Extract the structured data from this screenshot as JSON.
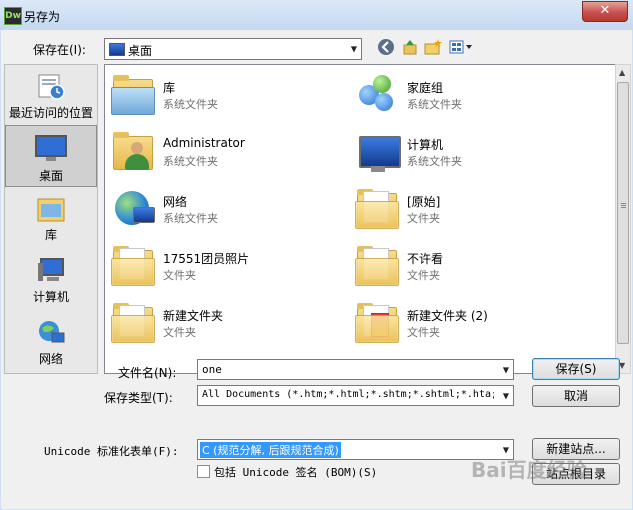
{
  "window": {
    "title": "另存为",
    "app_icon_text": "Dw",
    "close_symbol": "✕"
  },
  "toolbar": {
    "save_in_label": "保存在(I):",
    "location": "桌面",
    "back_icon": "back-arrow-icon",
    "up_icon": "up-folder-icon",
    "new_folder_icon": "new-folder-icon",
    "view_icon": "view-menu-icon"
  },
  "places": [
    {
      "label": "最近访问的位置",
      "icon": "recent-places-icon"
    },
    {
      "label": "桌面",
      "icon": "desktop-icon",
      "selected": true
    },
    {
      "label": "库",
      "icon": "libraries-icon"
    },
    {
      "label": "计算机",
      "icon": "computer-icon"
    },
    {
      "label": "网络",
      "icon": "network-icon"
    }
  ],
  "files": [
    {
      "name": "库",
      "type": "系统文件夹",
      "icon": "libraries-icon"
    },
    {
      "name": "家庭组",
      "type": "系统文件夹",
      "icon": "homegroup-icon"
    },
    {
      "name": "Administrator",
      "type": "系统文件夹",
      "icon": "user-folder-icon"
    },
    {
      "name": "计算机",
      "type": "系统文件夹",
      "icon": "computer-icon"
    },
    {
      "name": "网络",
      "type": "系统文件夹",
      "icon": "network-icon"
    },
    {
      "name": "[原始]",
      "type": "文件夹",
      "icon": "folder-icon"
    },
    {
      "name": "17551团员照片",
      "type": "文件夹",
      "icon": "folder-icon"
    },
    {
      "name": "不许看",
      "type": "文件夹",
      "icon": "folder-icon"
    },
    {
      "name": "新建文件夹",
      "type": "文件夹",
      "icon": "folder-icon"
    },
    {
      "name": "新建文件夹 (2)",
      "type": "文件夹",
      "icon": "folder-icon"
    }
  ],
  "form": {
    "filename_label": "文件名(N):",
    "filename_value": "one",
    "filetype_label": "保存类型(T):",
    "filetype_value": "All Documents (*.htm;*.html;*.shtm;*.shtml;*.hta;",
    "unicode_label": "Unicode 标准化表单(F):",
    "unicode_value": "C (规范分解, 后跟规范合成)",
    "bom_label": "包括 Unicode 签名 (BOM)(S)",
    "bom_checked": false
  },
  "buttons": {
    "save": "保存(S)",
    "cancel": "取消",
    "new_site": "新建站点...",
    "site_root": "站点根目录"
  },
  "watermark": "Bai百度经验"
}
